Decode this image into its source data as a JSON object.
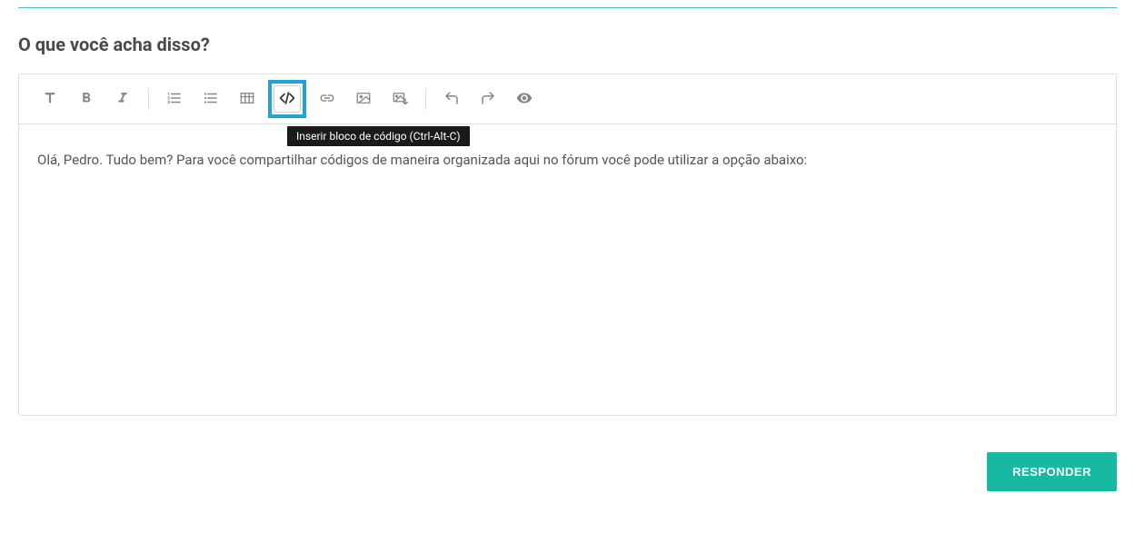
{
  "section": {
    "title": "O que você acha disso?"
  },
  "toolbar": {
    "tooltip_code": "Inserir bloco de código (Ctrl-Alt-C)"
  },
  "editor": {
    "content": "Olá, Pedro. Tudo bem? Para você compartilhar códigos de maneira organizada aqui no fórum você pode utilizar a opção abaixo:"
  },
  "actions": {
    "submit_label": "RESPONDER"
  }
}
